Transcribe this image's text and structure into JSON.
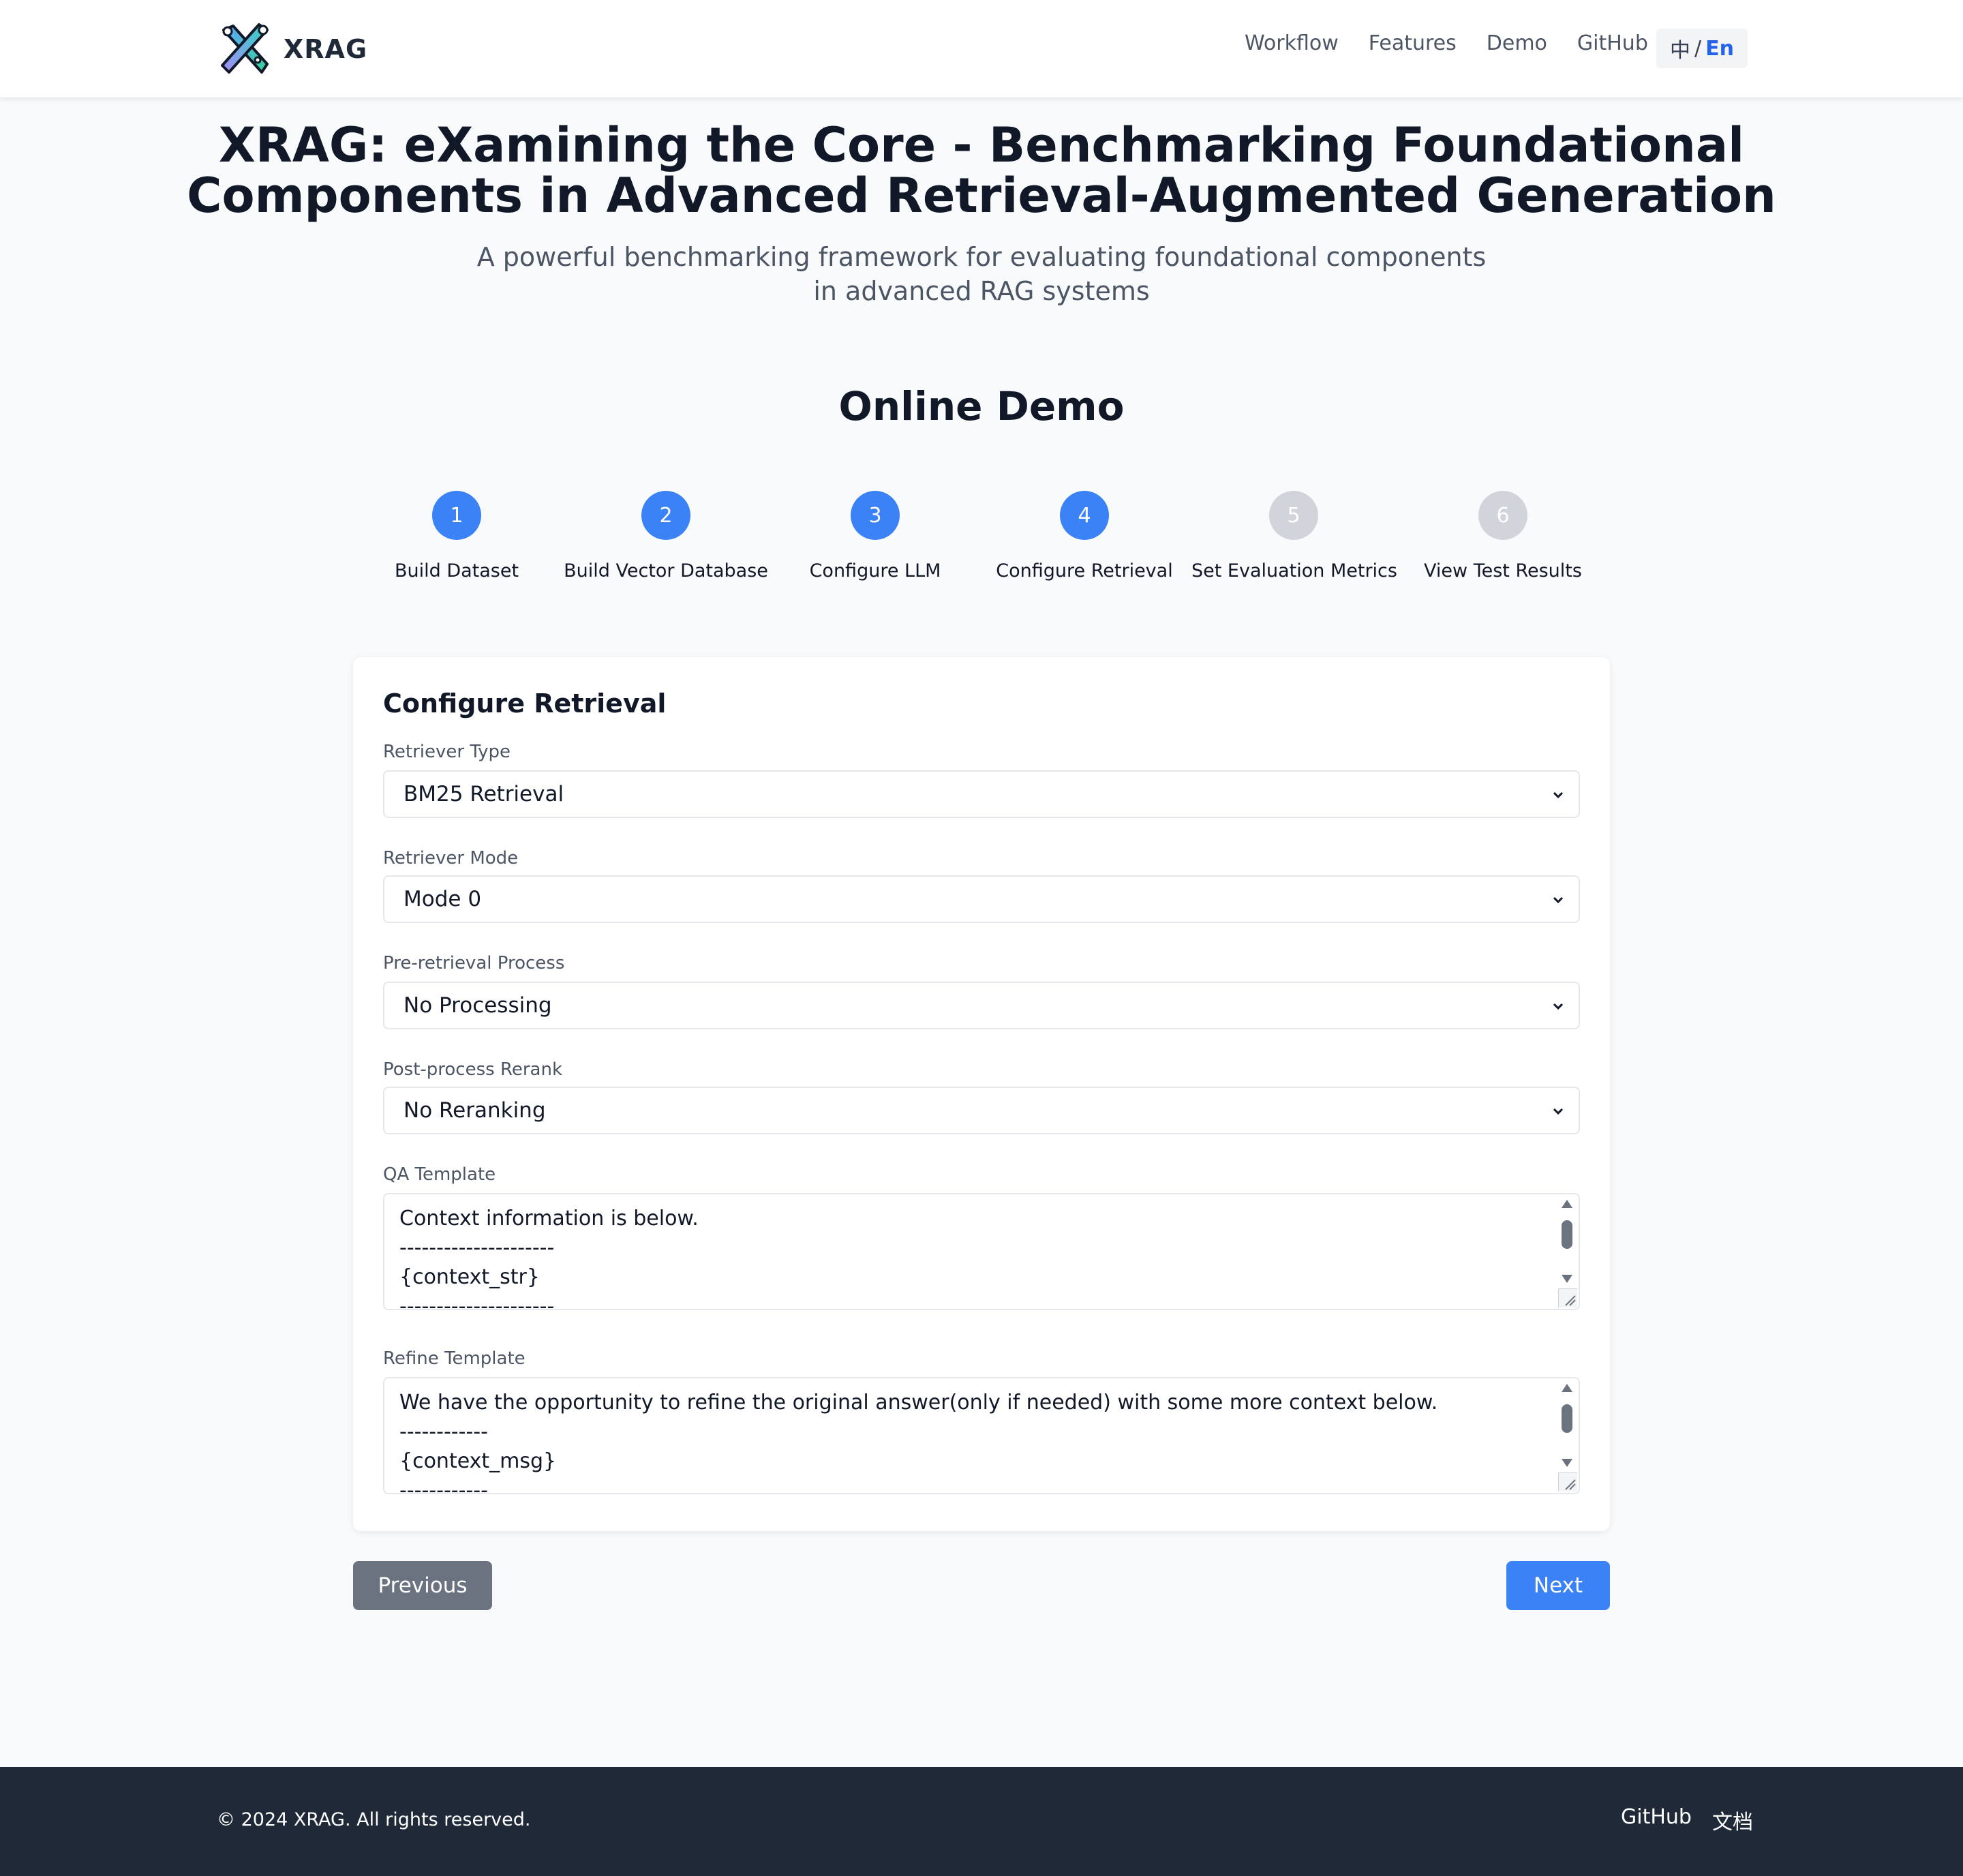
{
  "header": {
    "brand": "XRAG",
    "nav": [
      "Workflow",
      "Features",
      "Demo",
      "GitHub"
    ],
    "lang_zh": "中",
    "lang_sep": "/",
    "lang_en": "En"
  },
  "hero": {
    "title_line1": "XRAG: eXamining the Core - Benchmarking Foundational",
    "title_line2": "Components in Advanced Retrieval-Augmented Generation",
    "subtitle_line1": "A powerful benchmarking framework for evaluating foundational components",
    "subtitle_line2": "in advanced RAG systems"
  },
  "demo": {
    "title": "Online Demo",
    "steps": [
      {
        "number": "1",
        "label": "Build Dataset",
        "status": "done"
      },
      {
        "number": "2",
        "label": "Build Vector Database",
        "status": "done"
      },
      {
        "number": "3",
        "label": "Configure LLM",
        "status": "done"
      },
      {
        "number": "4",
        "label": "Configure Retrieval",
        "status": "current"
      },
      {
        "number": "5",
        "label": "Set Evaluation Metrics",
        "status": "pending"
      },
      {
        "number": "6",
        "label": "View Test Results",
        "status": "pending"
      }
    ]
  },
  "form": {
    "title": "Configure Retrieval",
    "retriever_type": {
      "label": "Retriever Type",
      "value": "BM25 Retrieval"
    },
    "retriever_mode": {
      "label": "Retriever Mode",
      "value": "Mode 0"
    },
    "pre_retrieval": {
      "label": "Pre-retrieval Process",
      "value": "No Processing"
    },
    "post_rerank": {
      "label": "Post-process Rerank",
      "value": "No Reranking"
    },
    "qa_template": {
      "label": "QA Template",
      "value": "Context information is below.\n---------------------\n{context_str}\n---------------------"
    },
    "refine_template": {
      "label": "Refine Template",
      "value": "We have the opportunity to refine the original answer(only if needed) with some more context below.\n------------\n{context_msg}\n------------"
    }
  },
  "buttons": {
    "previous": "Previous",
    "next": "Next"
  },
  "footer": {
    "copyright": "© 2024 XRAG. All rights reserved.",
    "links": [
      "GitHub",
      "文档"
    ]
  },
  "colors": {
    "accent": "#3b82f6",
    "inactive_step": "#d1d5db",
    "footer_bg": "#1f2937",
    "prev_button": "#6b7280"
  }
}
